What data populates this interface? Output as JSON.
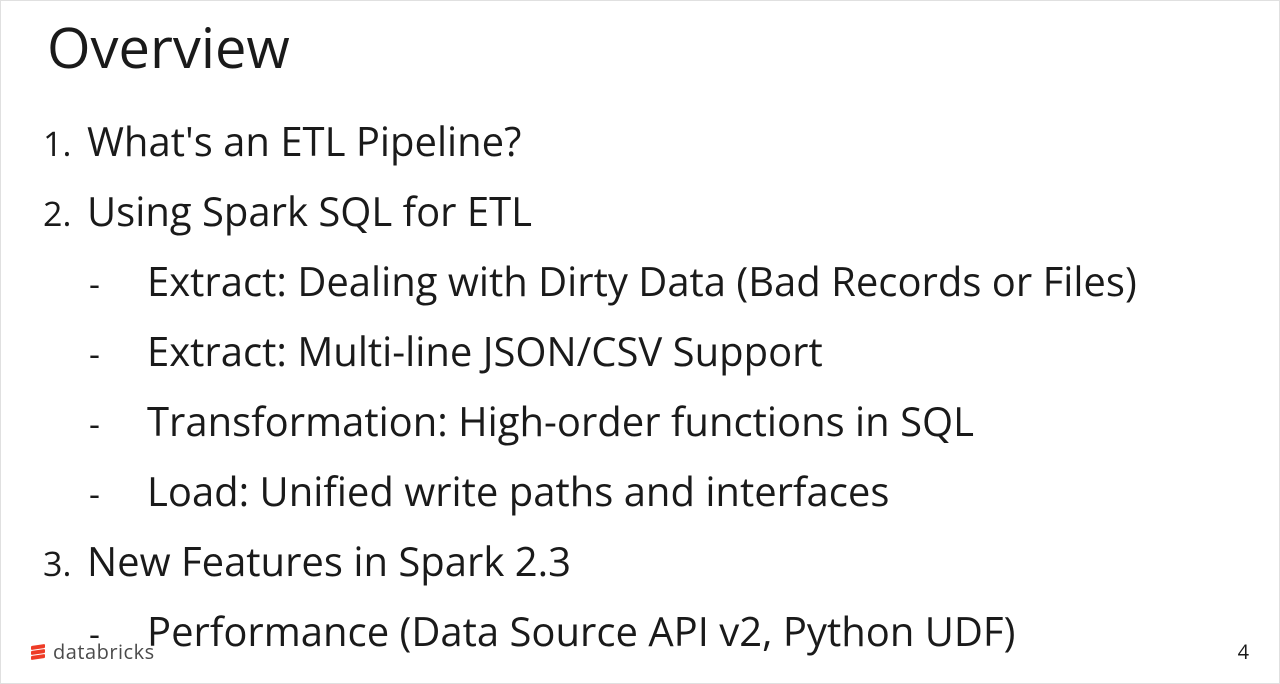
{
  "title": "Overview",
  "items": [
    {
      "number": "1.",
      "text": "What's an ETL Pipeline?",
      "subs": []
    },
    {
      "number": "2.",
      "text": "Using Spark SQL for ETL",
      "subs": [
        "Extract: Dealing with Dirty Data (Bad Records or Files)",
        "Extract: Multi-line JSON/CSV Support",
        "Transformation: High-order functions in SQL",
        "Load: Unified write paths and interfaces"
      ]
    },
    {
      "number": "3.",
      "text": "New Features in Spark 2.3",
      "subs": [
        "Performance (Data Source API v2, Python UDF)"
      ]
    }
  ],
  "footer": {
    "brand": "databricks",
    "page": "4"
  }
}
